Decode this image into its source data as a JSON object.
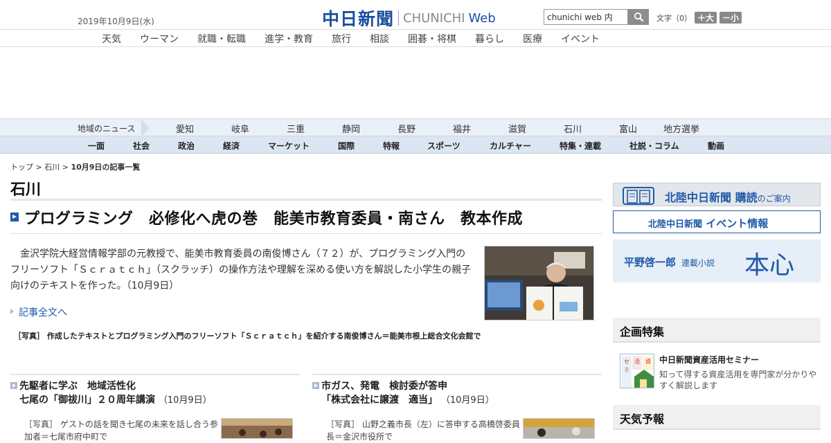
{
  "header": {
    "date": "2019年10月9日(水)",
    "logo_jp": "中日新聞",
    "logo_en": "CHUNICHI",
    "logo_web": "Web",
    "search_value": "chunichi web 内",
    "font_label": "文字（0）",
    "font_bigger": "＋大",
    "font_smaller": "－小"
  },
  "nav_main": [
    "天気",
    "ウーマン",
    "就職・転職",
    "進学・教育",
    "旅行",
    "相談",
    "囲碁・将棋",
    "暮らし",
    "医療",
    "イベント"
  ],
  "nav_region": {
    "label": "地域のニュース",
    "items": [
      "愛知",
      "岐阜",
      "三重",
      "静岡",
      "長野",
      "福井",
      "滋賀",
      "石川",
      "富山",
      "地方選挙"
    ]
  },
  "nav_category": [
    "一面",
    "社会",
    "政治",
    "経済",
    "マーケット",
    "国際",
    "特報",
    "スポーツ",
    "カルチャー",
    "特集・連載",
    "社説・コラム",
    "動画"
  ],
  "breadcrumb": {
    "top": "トップ",
    "sep1": " > ",
    "region": "石川",
    "sep2": " > ",
    "current": "10月9日の記事一覧"
  },
  "section_title": "石川",
  "lead_article": {
    "headline": "プログラミング　必修化へ虎の巻　能美市教育委員・南さん　教本作成",
    "body": "金沢学院大経営情報学部の元教授で、能美市教育委員の南俊博さん（７２）が、プログラミング入門のフリーソフト「Ｓｃｒａｔｃｈ」（スクラッチ）の操作方法や理解を深める使い方を解説した小学生の親子向けのテキストを作った。（10月9日）",
    "readmore": "記事全文へ",
    "caption": "［写真］ 作成したテキストとプログラミング入門のフリーソフト「Ｓｃｒａｔｃｈ」を紹介する南俊博さん＝能美市根上総合文化会館で"
  },
  "sub_articles": [
    {
      "title1": "先駆者に学ぶ　地域活性化",
      "title2": "七尾の「御祓川」２０周年講演",
      "date": "（10月9日）",
      "caption": "［写真］ ゲストの話を聞き七尾の未来を話し合う参加者＝七尾市府中町で"
    },
    {
      "title1": "市ガス、発電　検討委が答申",
      "title2": "「株式会社に譲渡　適当」",
      "date": "（10月9日）",
      "caption": "［写真］ 山野之義市長（左）に答申する高橋啓委員長＝金沢市役所で"
    }
  ],
  "sidebar": {
    "banner1": {
      "main": "北陸中日新聞 購読",
      "small": "のご案内"
    },
    "banner2": {
      "main": "北陸中日新聞",
      "small": "イベント情報"
    },
    "banner3": {
      "author": "平野啓一郎",
      "kind": "連載小説",
      "title": "本心"
    },
    "feature_head": "企画特集",
    "feature_title": "中日新聞資産活用セミナー",
    "feature_desc": "知って得する資産活用を専門家が分かりやすく解説します",
    "weather_head": "天気予報"
  },
  "colors": {
    "brand": "#1b4fa0",
    "link": "#1e5aa8",
    "nav_bg": "#e9f0f8",
    "cat_bg": "#dce6f2"
  }
}
